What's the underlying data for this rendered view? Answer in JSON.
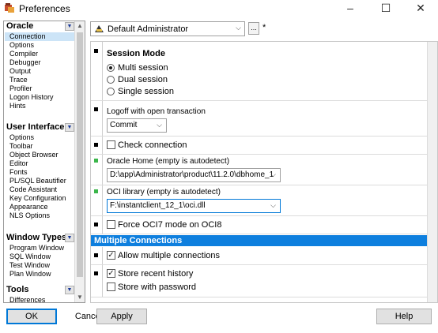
{
  "window": {
    "title": "Preferences",
    "minimize": "–",
    "maximize": "☐",
    "close": "✕"
  },
  "sidebar": {
    "groups": [
      {
        "name": "Oracle",
        "items": [
          "Connection",
          "Options",
          "Compiler",
          "Debugger",
          "Output",
          "Trace",
          "Profiler",
          "Logon History",
          "Hints"
        ],
        "selected": "Connection"
      },
      {
        "name": "User Interface",
        "items": [
          "Options",
          "Toolbar",
          "Object Browser",
          "Editor",
          "Fonts",
          "PL/SQL Beautifier",
          "Code Assistant",
          "Key Configuration",
          "Appearance",
          "NLS Options"
        ]
      },
      {
        "name": "Window Types",
        "items": [
          "Program Window",
          "SQL Window",
          "Test Window",
          "Plan Window"
        ]
      },
      {
        "name": "Tools",
        "items": [
          "Differences"
        ]
      }
    ]
  },
  "profile": {
    "value": "Default Administrator",
    "ellipsis": "...",
    "modified_marker": "*"
  },
  "session_mode": {
    "title": "Session Mode",
    "options": [
      "Multi session",
      "Dual session",
      "Single session"
    ],
    "selected": "Multi session"
  },
  "logoff": {
    "label": "Logoff with open transaction",
    "value": "Commit"
  },
  "check_connection": {
    "label": "Check connection",
    "checked": false
  },
  "oracle_home": {
    "label": "Oracle Home (empty is autodetect)",
    "value": "D:\\app\\Administrator\\product\\11.2.0\\dbhome_1"
  },
  "oci_library": {
    "label": "OCI library (empty is autodetect)",
    "value": "F:\\instantclient_12_1\\oci.dll"
  },
  "force_oci7": {
    "label": "Force OCI7 mode on OCI8",
    "checked": false
  },
  "multiple_connections": {
    "header": "Multiple Connections",
    "allow_multiple": {
      "label": "Allow multiple connections",
      "checked": true
    },
    "store_history": {
      "label": "Store recent history",
      "checked": true
    },
    "store_password": {
      "label": "Store with password",
      "checked": false
    }
  },
  "footer": {
    "ok": "OK",
    "cancel": "Cancel",
    "apply": "Apply",
    "help": "Help"
  },
  "colors": {
    "header_blue": "#0e7fde",
    "selected_item": "#cce4f7",
    "marker_green": "#3bb64a",
    "marker_black": "#000000"
  }
}
